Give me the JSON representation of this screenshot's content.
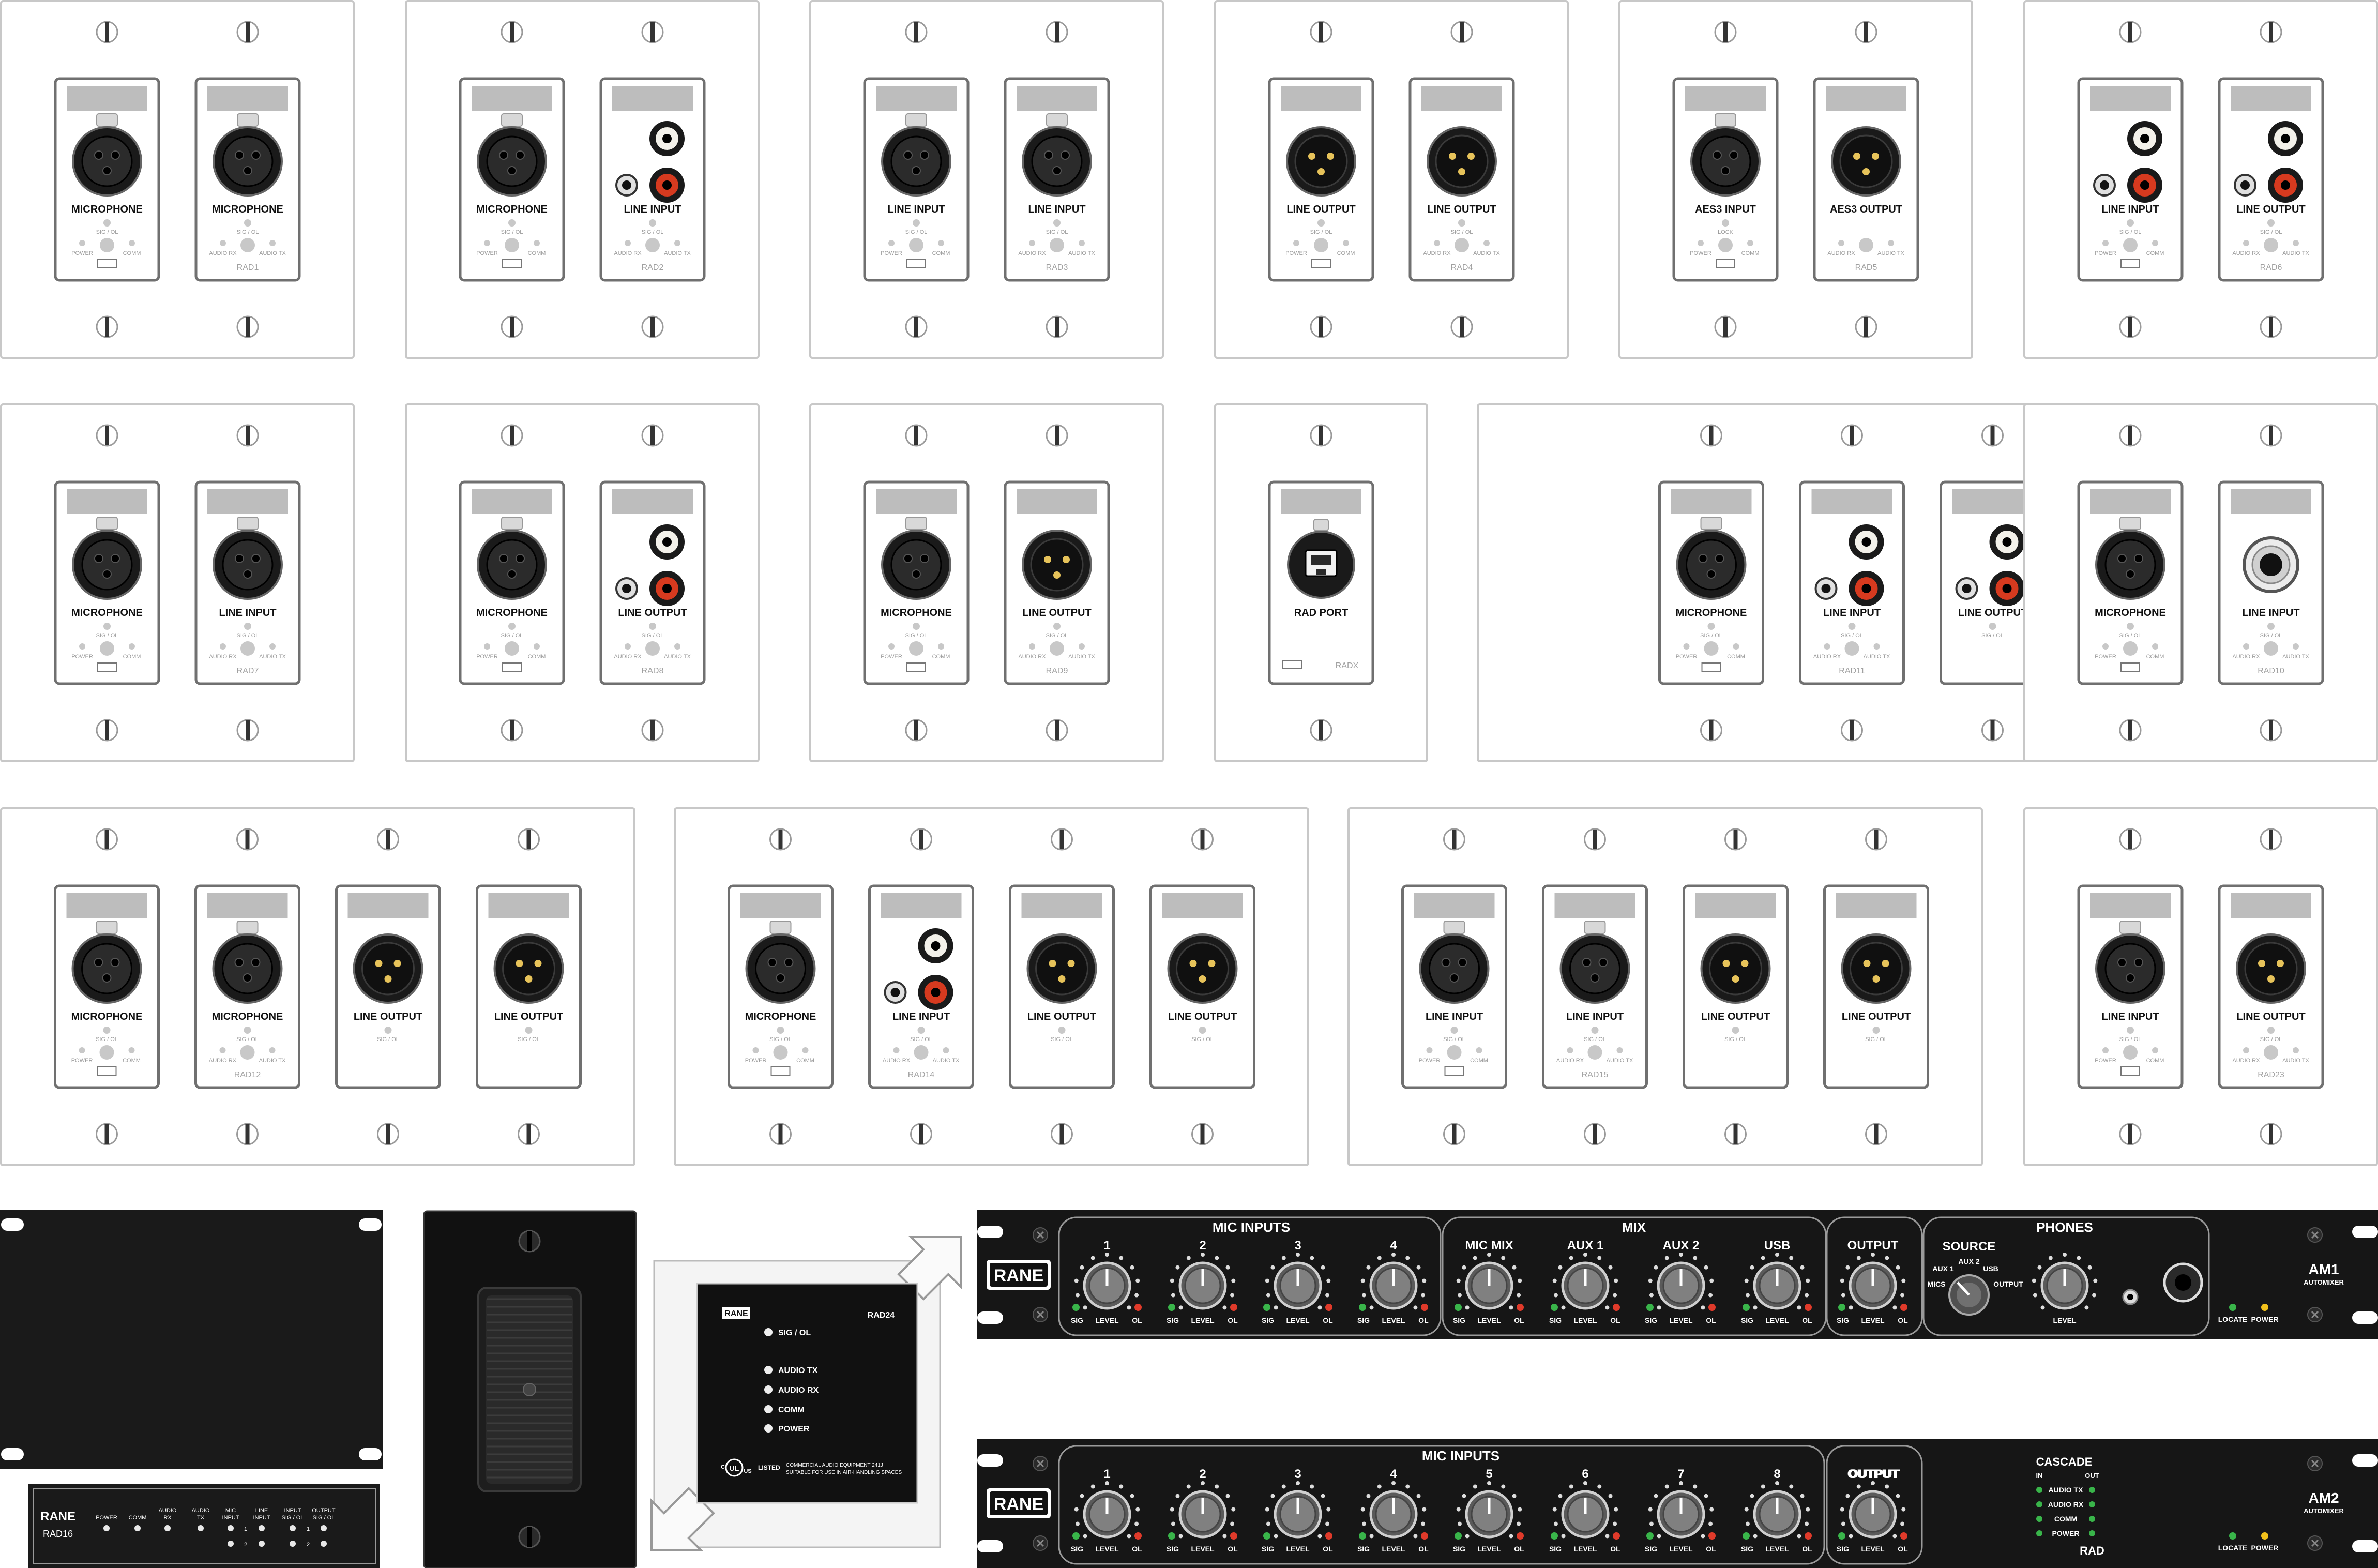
{
  "colors": {
    "plate": "#ffffff",
    "plate_border": "#c8c8c8",
    "module_fill": "#ffffff",
    "module_border": "#707070",
    "label_window": "#bdbdbd",
    "jack_black": "#1a1a1a",
    "pin_gold": "#e7c35a",
    "rca_white": "#f3f1ea",
    "rca_red": "#d63a1f",
    "led_grey": "#c8c8c8",
    "led_green": "#39b54a",
    "led_red": "#e03a2a",
    "led_yellow": "#f2c11b",
    "rack_black": "#161616",
    "rack_text": "#ffffff"
  },
  "wallplates": [
    {
      "name": "wallplate-rad1",
      "modules": [
        {
          "type": "xlr-f",
          "label": "MICROPHONE",
          "status": "SIG / OL",
          "bottom": "power-comm",
          "code": "RANE"
        },
        {
          "type": "xlr-f",
          "label": "MICROPHONE",
          "status": "SIG / OL",
          "bottom": "audio",
          "code": "RAD1"
        }
      ]
    },
    {
      "name": "wallplate-rad2",
      "modules": [
        {
          "type": "xlr-f",
          "label": "MICROPHONE",
          "status": "SIG / OL",
          "bottom": "power-comm",
          "code": "RANE"
        },
        {
          "type": "rca",
          "label": "LINE INPUT",
          "status": "SIG / OL",
          "bottom": "audio",
          "code": "RAD2"
        }
      ]
    },
    {
      "name": "wallplate-rad3",
      "modules": [
        {
          "type": "xlr-f",
          "label": "LINE INPUT",
          "status": "SIG / OL",
          "bottom": "power-comm",
          "code": "RANE"
        },
        {
          "type": "xlr-f",
          "label": "LINE INPUT",
          "status": "SIG / OL",
          "bottom": "audio",
          "code": "RAD3"
        }
      ]
    },
    {
      "name": "wallplate-rad4",
      "modules": [
        {
          "type": "xlr-m",
          "label": "LINE OUTPUT",
          "status": "SIG / OL",
          "bottom": "power-comm",
          "code": "RANE"
        },
        {
          "type": "xlr-m",
          "label": "LINE OUTPUT",
          "status": "SIG / OL",
          "bottom": "audio",
          "code": "RAD4"
        }
      ]
    },
    {
      "name": "wallplate-rad5",
      "modules": [
        {
          "type": "xlr-f",
          "label": "AES3 INPUT",
          "status": "LOCK",
          "bottom": "power-comm",
          "code": "RANE"
        },
        {
          "type": "xlr-m",
          "label": "AES3 OUTPUT",
          "status": "",
          "bottom": "audio",
          "code": "RAD5"
        }
      ]
    },
    {
      "name": "wallplate-rad6",
      "modules": [
        {
          "type": "rca",
          "label": "LINE INPUT",
          "status": "SIG / OL",
          "bottom": "power-comm",
          "code": "RANE"
        },
        {
          "type": "rca",
          "label": "LINE OUTPUT",
          "status": "SIG / OL",
          "bottom": "audio",
          "code": "RAD6"
        }
      ]
    },
    {
      "name": "wallplate-rad7",
      "modules": [
        {
          "type": "xlr-f",
          "label": "MICROPHONE",
          "status": "SIG / OL",
          "bottom": "power-comm",
          "code": "RANE"
        },
        {
          "type": "xlr-f",
          "label": "LINE INPUT",
          "status": "SIG / OL",
          "bottom": "audio",
          "code": "RAD7"
        }
      ]
    },
    {
      "name": "wallplate-rad8",
      "modules": [
        {
          "type": "xlr-f",
          "label": "MICROPHONE",
          "status": "SIG / OL",
          "bottom": "power-comm",
          "code": "RANE"
        },
        {
          "type": "rca",
          "label": "LINE OUTPUT",
          "status": "SIG / OL",
          "bottom": "audio",
          "code": "RAD8"
        }
      ]
    },
    {
      "name": "wallplate-rad9",
      "modules": [
        {
          "type": "xlr-f",
          "label": "MICROPHONE",
          "status": "SIG / OL",
          "bottom": "power-comm",
          "code": "RANE"
        },
        {
          "type": "xlr-m",
          "label": "LINE OUTPUT",
          "status": "SIG / OL",
          "bottom": "audio",
          "code": "RAD9"
        }
      ]
    },
    {
      "name": "wallplate-radx",
      "modules": [
        {
          "type": "rj45",
          "label": "RAD PORT",
          "status": "",
          "bottom": "radx",
          "code": "RADX"
        }
      ]
    },
    {
      "name": "wallplate-rad11",
      "modules": [
        {
          "type": "xlr-f",
          "label": "MICROPHONE",
          "status": "SIG / OL",
          "bottom": "power-comm",
          "code": "RANE"
        },
        {
          "type": "rca",
          "label": "LINE INPUT",
          "status": "SIG / OL",
          "bottom": "audio",
          "code": "RAD11"
        },
        {
          "type": "rca",
          "label": "LINE OUTPUT",
          "status": "SIG / OL",
          "bottom": "none",
          "code": ""
        }
      ]
    },
    {
      "name": "wallplate-rad10",
      "modules": [
        {
          "type": "xlr-f",
          "label": "MICROPHONE",
          "status": "SIG / OL",
          "bottom": "power-comm",
          "code": "RANE"
        },
        {
          "type": "trs",
          "label": "LINE INPUT",
          "status": "SIG / OL",
          "bottom": "audio",
          "code": "RAD10"
        }
      ]
    },
    {
      "name": "wallplate-rad12",
      "modules": [
        {
          "type": "xlr-f",
          "label": "MICROPHONE",
          "status": "SIG / OL",
          "bottom": "power-comm",
          "code": "RANE"
        },
        {
          "type": "xlr-f",
          "label": "MICROPHONE",
          "status": "SIG / OL",
          "bottom": "audio",
          "code": "RAD12"
        },
        {
          "type": "xlr-m",
          "label": "LINE OUTPUT",
          "status": "SIG / OL",
          "bottom": "none",
          "code": ""
        },
        {
          "type": "xlr-m",
          "label": "LINE OUTPUT",
          "status": "SIG / OL",
          "bottom": "none",
          "code": ""
        }
      ]
    },
    {
      "name": "wallplate-rad14",
      "modules": [
        {
          "type": "xlr-f",
          "label": "MICROPHONE",
          "status": "SIG / OL",
          "bottom": "power-comm",
          "code": "RANE"
        },
        {
          "type": "rca",
          "label": "LINE INPUT",
          "status": "SIG / OL",
          "bottom": "audio",
          "code": "RAD14"
        },
        {
          "type": "xlr-m",
          "label": "LINE OUTPUT",
          "status": "SIG / OL",
          "bottom": "none",
          "code": ""
        },
        {
          "type": "xlr-m",
          "label": "LINE OUTPUT",
          "status": "SIG / OL",
          "bottom": "none",
          "code": ""
        }
      ]
    },
    {
      "name": "wallplate-rad15",
      "modules": [
        {
          "type": "xlr-f",
          "label": "LINE INPUT",
          "status": "SIG / OL",
          "bottom": "power-comm",
          "code": "RANE"
        },
        {
          "type": "xlr-f",
          "label": "LINE INPUT",
          "status": "SIG / OL",
          "bottom": "audio",
          "code": "RAD15"
        },
        {
          "type": "xlr-m",
          "label": "LINE OUTPUT",
          "status": "SIG / OL",
          "bottom": "none",
          "code": ""
        },
        {
          "type": "xlr-m",
          "label": "LINE OUTPUT",
          "status": "SIG / OL",
          "bottom": "none",
          "code": ""
        }
      ]
    },
    {
      "name": "wallplate-rad23",
      "modules": [
        {
          "type": "xlr-f",
          "label": "LINE INPUT",
          "status": "SIG / OL",
          "bottom": "power-comm",
          "code": "RANE"
        },
        {
          "type": "xlr-m",
          "label": "LINE OUTPUT",
          "status": "SIG / OL",
          "bottom": "audio",
          "code": "RAD23"
        }
      ]
    }
  ],
  "module_small_labels": {
    "power": "POWER",
    "comm": "COMM",
    "audio_rx": "AUDIO RX",
    "audio_tx": "AUDIO TX",
    "brand": "RANE"
  },
  "rad16": {
    "brand": "RANE",
    "model": "RAD16",
    "power": "POWER",
    "comm": "COMM",
    "audio_rx": [
      "AUDIO",
      "RX"
    ],
    "audio_tx": [
      "AUDIO",
      "TX"
    ],
    "mic_input": [
      "MIC",
      "INPUT"
    ],
    "line_input": [
      "LINE",
      "INPUT"
    ],
    "input_sig_ol": [
      "INPUT",
      "SIG / OL"
    ],
    "output_sig_ol": [
      "OUTPUT",
      "SIG / OL"
    ],
    "num1": "1",
    "num2": "2"
  },
  "rad24": {
    "brand": "RANE",
    "model": "RAD24",
    "indicators": [
      "SIG / OL",
      "AUDIO TX",
      "AUDIO RX",
      "COMM",
      "POWER"
    ],
    "ul_mark": "UL",
    "ul_c": "C",
    "ul_us": "US",
    "listed": "LISTED",
    "notice_1": "COMMERCIAL AUDIO EQUIPMENT 241J",
    "notice_2": "SUITABLE FOR USE IN AIR-HANDLING SPACES"
  },
  "am1": {
    "brand": "RANE",
    "model": "AM1",
    "model_sub": "AUTOMIXER",
    "sections": {
      "mic_inputs": "MIC INPUTS",
      "mix": "MIX",
      "phones": "PHONES",
      "output": "OUTPUT"
    },
    "knobs": [
      "1",
      "2",
      "3",
      "4",
      "MIC MIX",
      "AUX 1",
      "AUX 2",
      "USB",
      "OUTPUT"
    ],
    "knob_sub": {
      "sig": "SIG",
      "level": "LEVEL",
      "ol": "OL"
    },
    "source": {
      "title": "SOURCE",
      "mics": "MICS",
      "aux1": "AUX 1",
      "aux2": "AUX 2",
      "usb": "USB",
      "output": "OUTPUT"
    },
    "phones_level": "LEVEL",
    "locate": "LOCATE",
    "power": "POWER"
  },
  "am2": {
    "brand": "RANE",
    "model": "AM2",
    "model_sub": "AUTOMIXER",
    "sections": {
      "mic_inputs": "MIC INPUTS",
      "output": "OUTPUT"
    },
    "knobs": [
      "1",
      "2",
      "3",
      "4",
      "5",
      "6",
      "7",
      "8",
      "OUTPUT"
    ],
    "knob_sub": {
      "sig": "SIG",
      "level": "LEVEL",
      "ol": "OL"
    },
    "cascade": {
      "title": "CASCADE",
      "in": "IN",
      "out": "OUT",
      "rows": [
        "AUDIO TX",
        "AUDIO RX",
        "COMM",
        "POWER"
      ],
      "footer": "RAD"
    },
    "locate": "LOCATE",
    "power": "POWER"
  }
}
